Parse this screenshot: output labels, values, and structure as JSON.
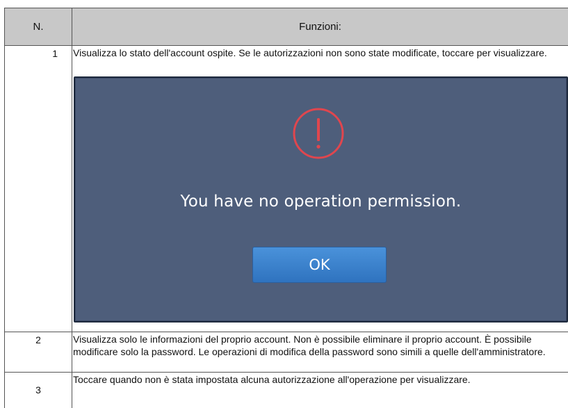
{
  "header": {
    "col_number": "N.",
    "col_functions": "Funzioni:"
  },
  "rows": [
    {
      "number": "1",
      "text": "Visualizza lo stato dell'account ospite. Se le autorizzazioni non sono state modificate, toccare per visualizzare."
    },
    {
      "number": "2",
      "text": "Visualizza solo le informazioni del proprio account. Non è possibile eliminare il proprio account. È possibile modificare solo la password. Le operazioni di modifica della password sono simili a quelle dell'amministratore."
    },
    {
      "number": "3",
      "text": "Toccare quando non è stata impostata alcuna autorizzazione all'operazione per visualizzare."
    }
  ],
  "dialog": {
    "icon": "warning-exclamation-icon",
    "message": "You have no operation permission.",
    "ok_label": "OK",
    "colors": {
      "background": "#4e5e7b",
      "icon": "#e0464e",
      "button": "#3a82cf"
    }
  }
}
